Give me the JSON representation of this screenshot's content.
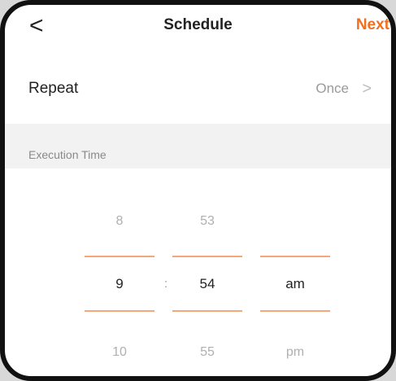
{
  "header": {
    "back_icon": "chevron-left-icon",
    "back_glyph": "<",
    "title": "Schedule",
    "next_label": "Next",
    "accent_color": "#f26e21"
  },
  "repeat": {
    "label": "Repeat",
    "value": "Once",
    "chevron_icon": "chevron-right-icon",
    "chevron_glyph": ">"
  },
  "execution_time": {
    "label": "Execution Time"
  },
  "picker": {
    "hour": {
      "prev": "8",
      "selected": "9",
      "next": "10"
    },
    "separator": ":",
    "minute": {
      "prev": "53",
      "selected": "54",
      "next": "55"
    },
    "period": {
      "prev": "",
      "selected": "am",
      "next": "pm"
    },
    "line_color": "#f5a77c"
  }
}
